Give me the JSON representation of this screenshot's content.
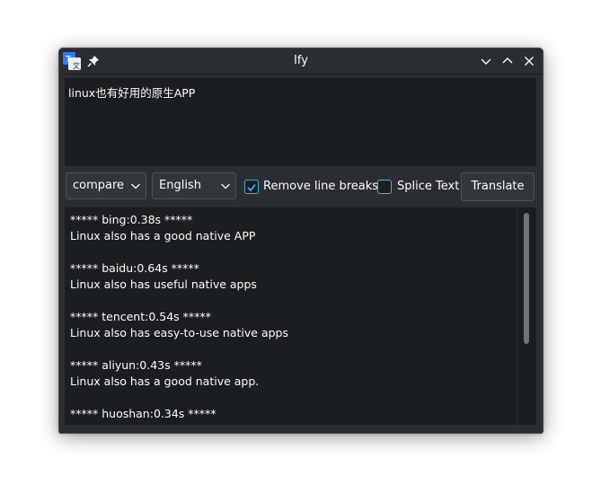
{
  "window": {
    "title": "Ify",
    "app_icon": "translate-app-icon",
    "pin_icon": "pin-icon",
    "controls": [
      "minimize-icon",
      "maximize-icon",
      "close-icon"
    ]
  },
  "input": {
    "text": "linux也有好用的原生APP"
  },
  "toolbar": {
    "mode": "compare",
    "language": "English",
    "remove_line_breaks": {
      "label": "Remove line breaks",
      "checked": true
    },
    "splice_text": {
      "label": "Splice Text",
      "checked": false
    },
    "translate_label": "Translate"
  },
  "output": {
    "results": [
      {
        "header": "***** bing:0.38s *****",
        "text": "Linux also has a good native APP"
      },
      {
        "header": "***** baidu:0.64s *****",
        "text": "Linux also has useful native apps"
      },
      {
        "header": "***** tencent:0.54s *****",
        "text": "Linux also has easy-to-use native apps"
      },
      {
        "header": "***** aliyun:0.43s *****",
        "text": "Linux also has a good native app."
      },
      {
        "header": "***** huoshan:0.34s *****",
        "text": ""
      }
    ]
  },
  "colors": {
    "window_bg": "#2a2e32",
    "text_area_bg": "#1b1e20",
    "accent": "#3daee9",
    "text": "#fcfcfc"
  }
}
